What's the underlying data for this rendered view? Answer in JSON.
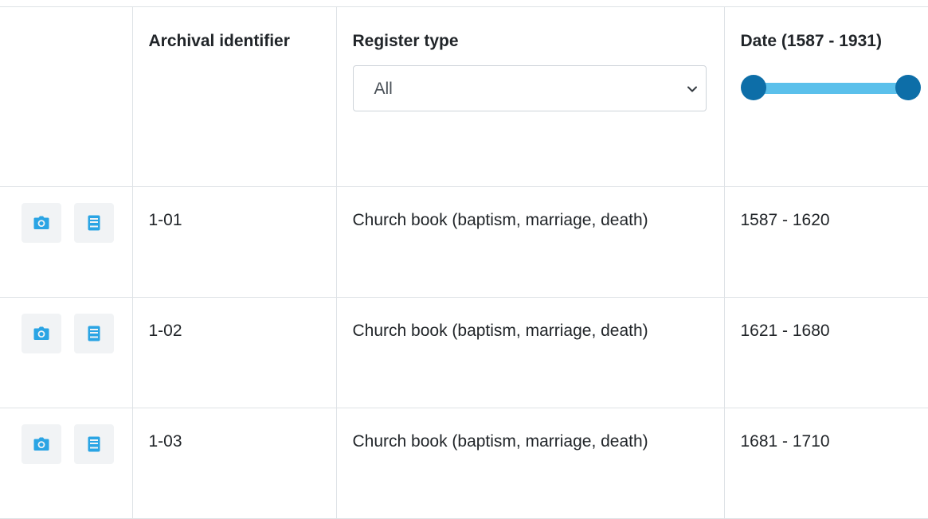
{
  "table": {
    "headers": {
      "actions": "",
      "archival_identifier": "Archival identifier",
      "register_type": "Register type",
      "date": "Date (1587 - 1931)"
    },
    "register_type_filter": {
      "selected": "All"
    },
    "date_slider": {
      "min": 1587,
      "max": 1931,
      "low": 1587,
      "high": 1931
    },
    "rows": [
      {
        "identifier": "1-01",
        "register_type": "Church book (baptism, marriage, death)",
        "date": "1587 - 1620"
      },
      {
        "identifier": "1-02",
        "register_type": "Church book (baptism, marriage, death)",
        "date": "1621 - 1680"
      },
      {
        "identifier": "1-03",
        "register_type": "Church book (baptism, marriage, death)",
        "date": "1681 - 1710"
      }
    ]
  },
  "icons": {
    "camera": "camera-icon",
    "book": "book-icon",
    "chevron": "chevron-down-icon",
    "icon_color": "#2aa4e4"
  }
}
